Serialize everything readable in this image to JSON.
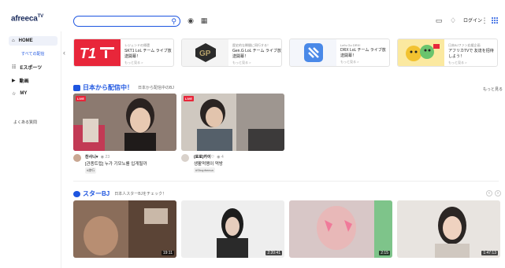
{
  "header": {
    "logo": "afreeca",
    "logo_sup": "TV",
    "search_placeholder": "",
    "login_label": "ログイン"
  },
  "sidebar": {
    "items": [
      {
        "label": "HOME",
        "icon": "home-icon"
      },
      {
        "label": "Eスポーツ",
        "icon": "esports-icon"
      },
      {
        "label": "動画",
        "icon": "video-icon"
      },
      {
        "label": "MY",
        "icon": "my-icon"
      }
    ],
    "home_sub": "すべての配信",
    "more": "よくある質問"
  },
  "banners": [
    {
      "t1": "レジェンドの帰還",
      "t2": "SKT1 LoL チーム ライブ放送開幕！",
      "t3": "もっと見る >",
      "logo_color": "#e8263a"
    },
    {
      "t1": "歴史的な瞬間に同行する！",
      "t2": "Gen.G LoL チーム ライブ放送開幕！",
      "t3": "もっと見る >",
      "logo_color": "#b6a26a"
    },
    {
      "t1": "Let's Go DRX!",
      "t2": "DRX LoL チーム ライブ放送開幕！",
      "t3": "もっと見る >",
      "logo_color": "#4a89e8"
    },
    {
      "t1": "日本BJファン応援企画",
      "t2": "アフリカTVで 友達を招待しよう！",
      "t3": "もっと見る >",
      "logo_color": "#f2c230"
    }
  ],
  "section1": {
    "title": "日本から配信中！",
    "sub": "日本から配信中のBJ",
    "more": "もっと見る",
    "cards": [
      {
        "badge": "LIVE",
        "streamer": "찬사니♥",
        "views": "23",
        "title": "[관종트립] 누가 기모노를 입게될까",
        "tag": "#旅行"
      },
      {
        "badge": "LIVE",
        "streamer": "(로로)카이♡",
        "views": "4",
        "title": "생활먹팽이 먹방",
        "tag": "#Shopfreeca"
      }
    ]
  },
  "section2": {
    "title": "スターBJ",
    "sub": "日本人スターBJをチェック！",
    "durations": [
      "19:11",
      "2:20:41",
      "2:15",
      "1:47:13"
    ]
  },
  "colors": {
    "accent": "#1d55e0",
    "live": "#e8263a"
  }
}
